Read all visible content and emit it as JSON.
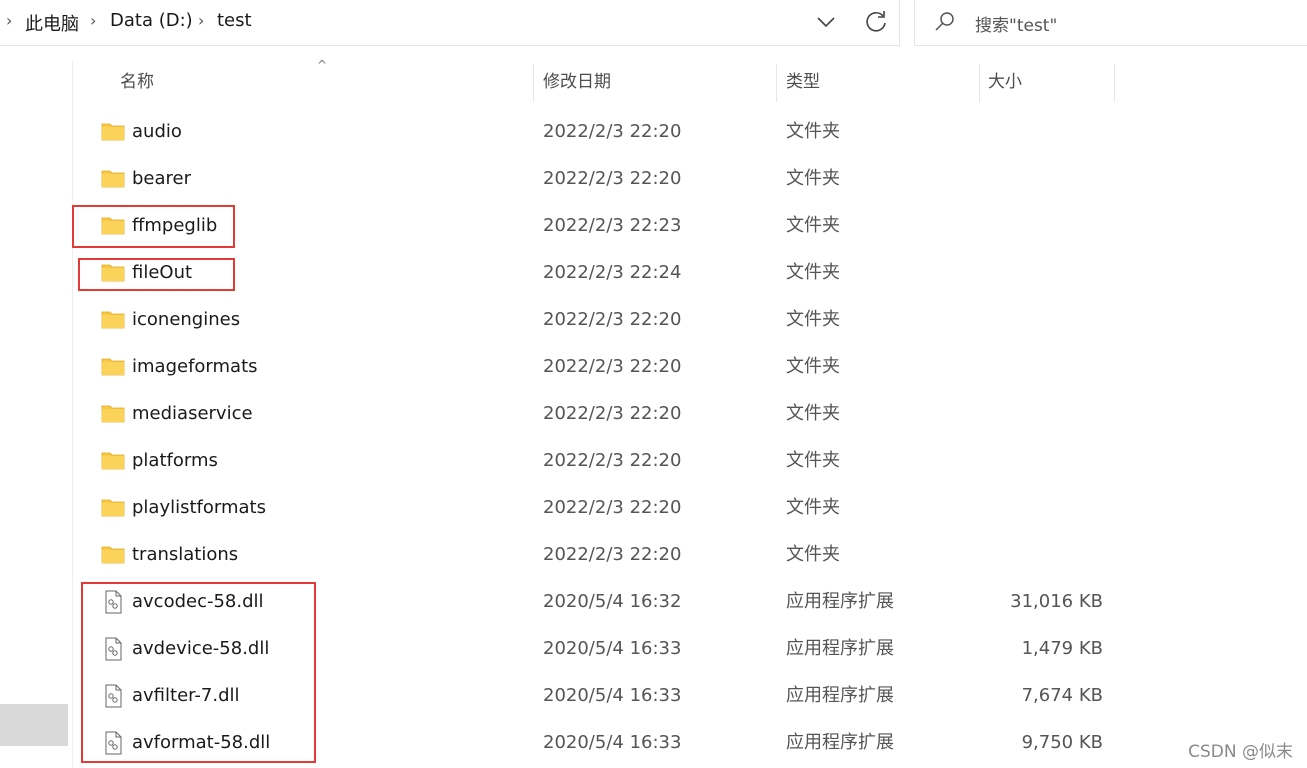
{
  "breadcrumb": {
    "items": [
      "此电脑",
      "Data (D:)",
      "test"
    ],
    "separator": "›"
  },
  "search": {
    "placeholder": "搜索\"test\""
  },
  "columns": {
    "name": "名称",
    "modified": "修改日期",
    "type": "类型",
    "size": "大小"
  },
  "files": [
    {
      "name": "audio",
      "modified": "2022/2/3 22:20",
      "type": "文件夹",
      "size": "",
      "kind": "folder"
    },
    {
      "name": "bearer",
      "modified": "2022/2/3 22:20",
      "type": "文件夹",
      "size": "",
      "kind": "folder"
    },
    {
      "name": "ffmpeglib",
      "modified": "2022/2/3 22:23",
      "type": "文件夹",
      "size": "",
      "kind": "folder"
    },
    {
      "name": "fileOut",
      "modified": "2022/2/3 22:24",
      "type": "文件夹",
      "size": "",
      "kind": "folder"
    },
    {
      "name": "iconengines",
      "modified": "2022/2/3 22:20",
      "type": "文件夹",
      "size": "",
      "kind": "folder"
    },
    {
      "name": "imageformats",
      "modified": "2022/2/3 22:20",
      "type": "文件夹",
      "size": "",
      "kind": "folder"
    },
    {
      "name": "mediaservice",
      "modified": "2022/2/3 22:20",
      "type": "文件夹",
      "size": "",
      "kind": "folder"
    },
    {
      "name": "platforms",
      "modified": "2022/2/3 22:20",
      "type": "文件夹",
      "size": "",
      "kind": "folder"
    },
    {
      "name": "playlistformats",
      "modified": "2022/2/3 22:20",
      "type": "文件夹",
      "size": "",
      "kind": "folder"
    },
    {
      "name": "translations",
      "modified": "2022/2/3 22:20",
      "type": "文件夹",
      "size": "",
      "kind": "folder"
    },
    {
      "name": "avcodec-58.dll",
      "modified": "2020/5/4 16:32",
      "type": "应用程序扩展",
      "size": "31,016 KB",
      "kind": "dll"
    },
    {
      "name": "avdevice-58.dll",
      "modified": "2020/5/4 16:33",
      "type": "应用程序扩展",
      "size": "1,479 KB",
      "kind": "dll"
    },
    {
      "name": "avfilter-7.dll",
      "modified": "2020/5/4 16:33",
      "type": "应用程序扩展",
      "size": "7,674 KB",
      "kind": "dll"
    },
    {
      "name": "avformat-58.dll",
      "modified": "2020/5/4 16:33",
      "type": "应用程序扩展",
      "size": "9,750 KB",
      "kind": "dll"
    }
  ],
  "icons": {
    "folder": "folder-icon",
    "dll": "dll-file-icon",
    "search": "search-icon",
    "refresh": "refresh-icon",
    "dropdown": "chevron-down-icon"
  },
  "colors": {
    "folder": "#f8c843",
    "highlight": "#e53935"
  },
  "watermark": "CSDN @似末"
}
